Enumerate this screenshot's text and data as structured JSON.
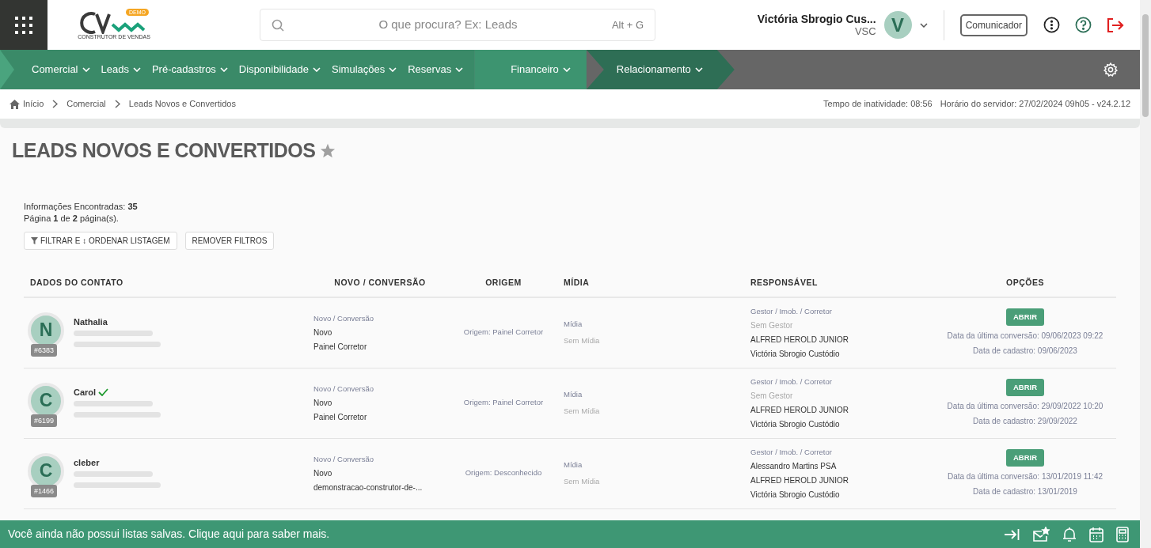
{
  "header": {
    "search_placeholder": "O que procura? Ex: Leads",
    "shortcut": "Alt + G",
    "user_name": "Victória Sbrogio Cus...",
    "user_code": "VSC",
    "avatar_letter": "V",
    "communicator_button": "Comunicador",
    "logo_badge": "DEMO",
    "logo_caption": "CONSTRUTOR DE VENDAS"
  },
  "nav": [
    {
      "label": "Comercial",
      "kind": "main"
    },
    {
      "label": "Leads",
      "kind": "main"
    },
    {
      "label": "Pré-cadastros",
      "kind": "main"
    },
    {
      "label": "Disponibilidade",
      "kind": "main"
    },
    {
      "label": "Simulações",
      "kind": "main"
    },
    {
      "label": "Reservas",
      "kind": "main"
    },
    {
      "label": "Financeiro",
      "kind": "light"
    },
    {
      "label": "Relacionamento",
      "kind": "dark"
    }
  ],
  "breadcrumb": [
    "Início",
    "Comercial",
    "Leads Novos e Convertidos"
  ],
  "status": [
    "Tempo de inatividade: 08:56",
    "Horário do servidor: 27/02/2024 09h05 - v24.2.12"
  ],
  "page_title": "LEADS NOVOS E CONVERTIDOS",
  "summary": [
    "Informações Encontradas: **35**",
    "Página **1** de **2** página(s)."
  ],
  "buttons": [
    "FILTRAR E ↕ ORDENAR LISTAGEM",
    "REMOVER FILTROS"
  ],
  "table": {
    "columns": [
      "DADOS DO CONTATO",
      "NOVO / CONVERSÃO",
      "ORIGEM",
      "MÍDIA",
      "RESPONSÁVEL",
      "OPÇÕES"
    ],
    "rows": [
      {
        "initial": "N",
        "name": "Nathalia",
        "verified": false,
        "id": "#6383",
        "novo_label": "Novo / Conversão",
        "novo_type": "Novo",
        "novo_source": "Painel Corretor",
        "origem": "Origem: Painel Corretor",
        "midia_label": "Mídia",
        "midia_value": "Sem Mídia",
        "resp_label": "Gestor / Imob. / Corretor",
        "responsaveis": [
          {
            "name": "Sem Gestor",
            "muted": true
          },
          {
            "name": "ALFRED HEROLD JUNIOR",
            "muted": false
          },
          {
            "name": "Victória Sbrogio Custódio",
            "muted": false
          }
        ],
        "button": "ABRIR",
        "last_conversion": "Data da última conversão: 09/06/2023 09:22",
        "created": "Data de cadastro: 09/06/2023"
      },
      {
        "initial": "C",
        "name": "Carol",
        "verified": true,
        "id": "#6199",
        "novo_label": "Novo / Conversão",
        "novo_type": "Novo",
        "novo_source": "Painel Corretor",
        "origem": "Origem: Painel Corretor",
        "midia_label": "Mídia",
        "midia_value": "Sem Mídia",
        "resp_label": "Gestor / Imob. / Corretor",
        "responsaveis": [
          {
            "name": "Sem Gestor",
            "muted": true
          },
          {
            "name": "ALFRED HEROLD JUNIOR",
            "muted": false
          },
          {
            "name": "Victória Sbrogio Custódio",
            "muted": false
          }
        ],
        "button": "ABRIR",
        "last_conversion": "Data da última conversão: 29/09/2022 10:20",
        "created": "Data de cadastro: 29/09/2022"
      },
      {
        "initial": "C",
        "name": "cleber",
        "verified": false,
        "id": "#1466",
        "novo_label": "Novo / Conversão",
        "novo_type": "Novo",
        "novo_source": "demonstracao-construtor-de-...",
        "origem": "Origem: Desconhecido",
        "midia_label": "Mídia",
        "midia_value": "Sem Mídia",
        "resp_label": "Gestor / Imob. / Corretor",
        "responsaveis": [
          {
            "name": "Alessandro Martins PSA",
            "muted": false
          },
          {
            "name": "ALFRED HEROLD JUNIOR",
            "muted": false
          },
          {
            "name": "Victória Sbrogio Custódio",
            "muted": false
          }
        ],
        "button": "ABRIR",
        "last_conversion": "Data da última conversão: 13/01/2019 11:42",
        "created": "Data de cadastro: 13/01/2019"
      }
    ]
  },
  "footer": {
    "message": "Você ainda não possui listas salvas. Clique aqui para saber mais."
  }
}
